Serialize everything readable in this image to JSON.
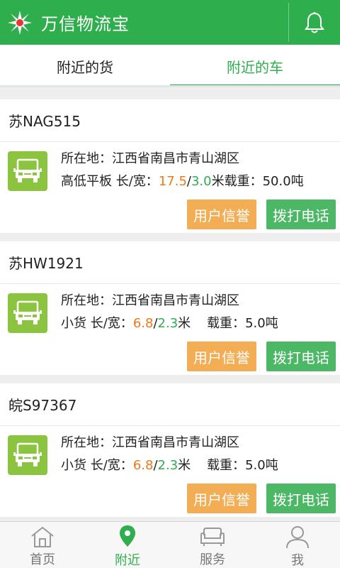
{
  "app": {
    "title": "万信物流宝"
  },
  "tabs": [
    {
      "label": "附近的货",
      "active": false
    },
    {
      "label": "附近的车",
      "active": true
    }
  ],
  "cards": [
    {
      "plate": "苏NAG515",
      "location_label": "所在地：",
      "location": "江西省南昌市青山湖区",
      "type": "高低平板",
      "size_label": "长/宽：",
      "length": "17.5",
      "slash": "/",
      "width": "3.0",
      "unit": "米",
      "load_label": "载重：",
      "load": "50.0吨",
      "credit_button": "用户信誉",
      "call_button": "拨打电话"
    },
    {
      "plate": "苏HW1921",
      "location_label": "所在地：",
      "location": "江西省南昌市青山湖区",
      "type": "小货",
      "size_label": "长/宽：",
      "length": "6.8",
      "slash": "/",
      "width": "2.3",
      "unit": "米",
      "load_label": "载重：",
      "load": "5.0吨",
      "credit_button": "用户信誉",
      "call_button": "拨打电话"
    },
    {
      "plate": "皖S97367",
      "location_label": "所在地：",
      "location": "江西省南昌市青山湖区",
      "type": "小货",
      "size_label": "长/宽：",
      "length": "6.8",
      "slash": "/",
      "width": "2.3",
      "unit": "米",
      "load_label": "载重：",
      "load": "5.0吨",
      "credit_button": "用户信誉",
      "call_button": "拨打电话"
    }
  ],
  "bottom_nav": [
    {
      "label": "首页",
      "icon": "home-icon",
      "active": false
    },
    {
      "label": "附近",
      "icon": "location-pin-icon",
      "active": true
    },
    {
      "label": "服务",
      "icon": "sofa-icon",
      "active": false
    },
    {
      "label": "我",
      "icon": "user-icon",
      "active": false
    }
  ],
  "colors": {
    "brand": "#2fae4e",
    "orange_value": "#ee7a16",
    "credit_button": "#f2ad55",
    "call_button": "#4cb866",
    "truck_icon_bg": "#8bc43f"
  }
}
